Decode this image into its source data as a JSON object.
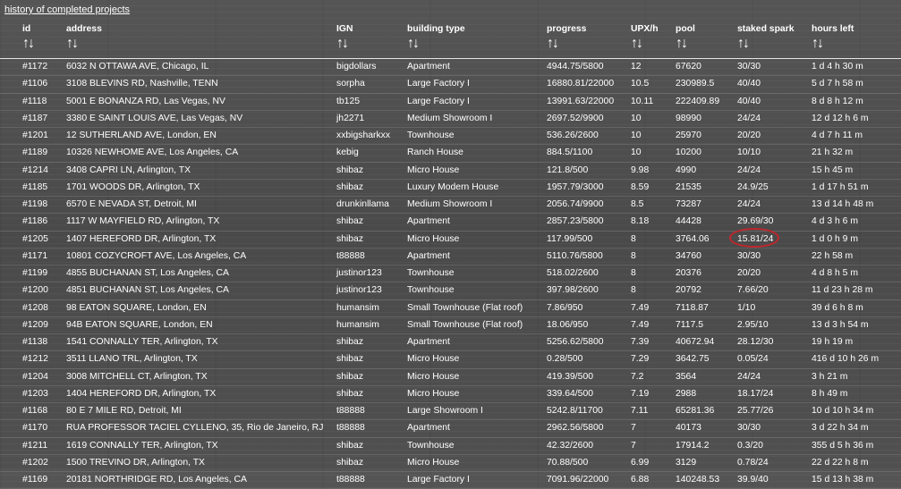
{
  "page": {
    "history_link": "history of completed projects"
  },
  "table": {
    "sort_glyph": "↑↓",
    "columns": [
      "id",
      "address",
      "IGN",
      "building type",
      "progress",
      "UPX/h",
      "pool",
      "staked spark",
      "hours left"
    ],
    "rows": [
      [
        "#1172",
        "6032 N OTTAWA AVE, Chicago, IL",
        "bigdollars",
        "Apartment",
        "4944.75/5800",
        "12",
        "67620",
        "30/30",
        "1 d 4 h 30 m"
      ],
      [
        "#1106",
        "3108 BLEVINS RD, Nashville, TENN",
        "sorpha",
        "Large Factory I",
        "16880.81/22000",
        "10.5",
        "230989.5",
        "40/40",
        "5 d 7 h 58 m"
      ],
      [
        "#1118",
        "5001 E BONANZA RD, Las Vegas, NV",
        "tb125",
        "Large Factory I",
        "13991.63/22000",
        "10.11",
        "222409.89",
        "40/40",
        "8 d 8 h 12 m"
      ],
      [
        "#1187",
        "3380 E SAINT LOUIS AVE, Las Vegas, NV",
        "jh2271",
        "Medium Showroom I",
        "2697.52/9900",
        "10",
        "98990",
        "24/24",
        "12 d 12 h 6 m"
      ],
      [
        "#1201",
        "12 SUTHERLAND AVE, London, EN",
        "xxbigsharkxx",
        "Townhouse",
        "536.26/2600",
        "10",
        "25970",
        "20/20",
        "4 d 7 h 11 m"
      ],
      [
        "#1189",
        "10326 NEWHOME AVE, Los Angeles, CA",
        "kebig",
        "Ranch House",
        "884.5/1100",
        "10",
        "10200",
        "10/10",
        "21 h 32 m"
      ],
      [
        "#1214",
        "3408 CAPRI LN, Arlington, TX",
        "shibaz",
        "Micro House",
        "121.8/500",
        "9.98",
        "4990",
        "24/24",
        "15 h 45 m"
      ],
      [
        "#1185",
        "1701 WOODS DR, Arlington, TX",
        "shibaz",
        "Luxury Modern House",
        "1957.79/3000",
        "8.59",
        "21535",
        "24.9/25",
        "1 d 17 h 51 m"
      ],
      [
        "#1198",
        "6570 E NEVADA ST, Detroit, MI",
        "drunkinllama",
        "Medium Showroom I",
        "2056.74/9900",
        "8.5",
        "73287",
        "24/24",
        "13 d 14 h 48 m"
      ],
      [
        "#1186",
        "1117 W MAYFIELD RD, Arlington, TX",
        "shibaz",
        "Apartment",
        "2857.23/5800",
        "8.18",
        "44428",
        "29.69/30",
        "4 d 3 h 6 m"
      ],
      [
        "#1205",
        "1407 HEREFORD DR, Arlington, TX",
        "shibaz",
        "Micro House",
        "117.99/500",
        "8",
        "3764.06",
        "15.81/24",
        "1 d 0 h 9 m"
      ],
      [
        "#1171",
        "10801 COZYCROFT AVE, Los Angeles, CA",
        "t88888",
        "Apartment",
        "5110.76/5800",
        "8",
        "34760",
        "30/30",
        "22 h 58 m"
      ],
      [
        "#1199",
        "4855 BUCHANAN ST, Los Angeles, CA",
        "justinor123",
        "Townhouse",
        "518.02/2600",
        "8",
        "20376",
        "20/20",
        "4 d 8 h 5 m"
      ],
      [
        "#1200",
        "4851 BUCHANAN ST, Los Angeles, CA",
        "justinor123",
        "Townhouse",
        "397.98/2600",
        "8",
        "20792",
        "7.66/20",
        "11 d 23 h 28 m"
      ],
      [
        "#1208",
        "98 EATON SQUARE, London, EN",
        "humansim",
        "Small Townhouse (Flat roof)",
        "7.86/950",
        "7.49",
        "7118.87",
        "1/10",
        "39 d 6 h 8 m"
      ],
      [
        "#1209",
        "94B EATON SQUARE, London, EN",
        "humansim",
        "Small Townhouse (Flat roof)",
        "18.06/950",
        "7.49",
        "7117.5",
        "2.95/10",
        "13 d 3 h 54 m"
      ],
      [
        "#1138",
        "1541 CONNALLY TER, Arlington, TX",
        "shibaz",
        "Apartment",
        "5256.62/5800",
        "7.39",
        "40672.94",
        "28.12/30",
        "19 h 19 m"
      ],
      [
        "#1212",
        "3511 LLANO TRL, Arlington, TX",
        "shibaz",
        "Micro House",
        "0.28/500",
        "7.29",
        "3642.75",
        "0.05/24",
        "416 d 10 h 26 m"
      ],
      [
        "#1204",
        "3008 MITCHELL CT, Arlington, TX",
        "shibaz",
        "Micro House",
        "419.39/500",
        "7.2",
        "3564",
        "24/24",
        "3 h 21 m"
      ],
      [
        "#1203",
        "1404 HEREFORD DR, Arlington, TX",
        "shibaz",
        "Micro House",
        "339.64/500",
        "7.19",
        "2988",
        "18.17/24",
        "8 h 49 m"
      ],
      [
        "#1168",
        "80 E 7 MILE RD, Detroit, MI",
        "t88888",
        "Large Showroom I",
        "5242.8/11700",
        "7.11",
        "65281.36",
        "25.77/26",
        "10 d 10 h 34 m"
      ],
      [
        "#1170",
        "RUA PROFESSOR TACIEL CYLLENO, 35, Rio de Janeiro, RJ",
        "t88888",
        "Apartment",
        "2962.56/5800",
        "7",
        "40173",
        "30/30",
        "3 d 22 h 34 m"
      ],
      [
        "#1211",
        "1619 CONNALLY TER, Arlington, TX",
        "shibaz",
        "Townhouse",
        "42.32/2600",
        "7",
        "17914.2",
        "0.3/20",
        "355 d 5 h 36 m"
      ],
      [
        "#1202",
        "1500 TREVINO DR, Arlington, TX",
        "shibaz",
        "Micro House",
        "70.88/500",
        "6.99",
        "3129",
        "0.78/24",
        "22 d 22 h 8 m"
      ],
      [
        "#1169",
        "20181 NORTHRIDGE RD, Los Angeles, CA",
        "t88888",
        "Large Factory I",
        "7091.96/22000",
        "6.88",
        "140248.53",
        "39.9/40",
        "15 d 13 h 38 m"
      ]
    ],
    "highlight": {
      "row": 10,
      "col": 7,
      "color": "#c0262c"
    }
  }
}
